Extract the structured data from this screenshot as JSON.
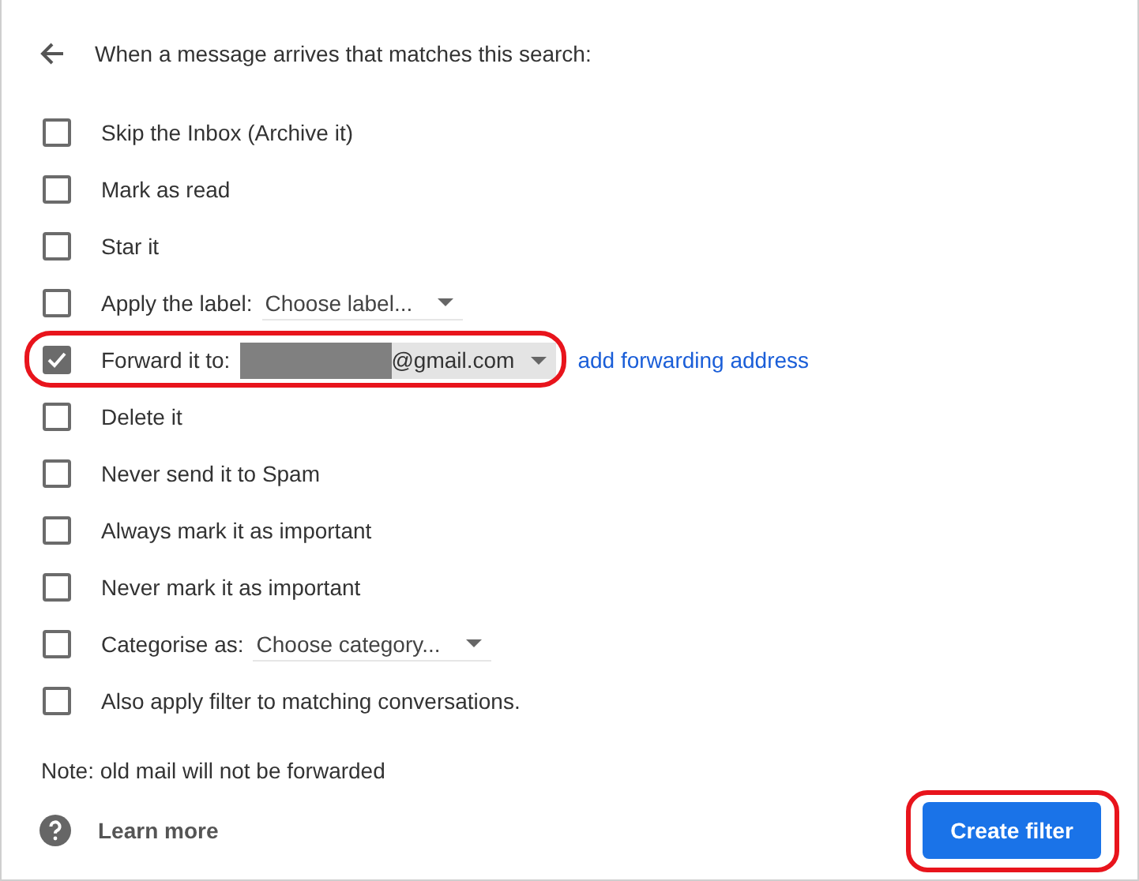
{
  "header": {
    "title": "When a message arrives that matches this search:"
  },
  "options": [
    {
      "kind": "plain",
      "label": "Skip the Inbox (Archive it)",
      "checked": false
    },
    {
      "kind": "plain",
      "label": "Mark as read",
      "checked": false
    },
    {
      "kind": "plain",
      "label": "Star it",
      "checked": false
    },
    {
      "kind": "select",
      "label": "Apply the label:",
      "value": "Choose label...",
      "checked": false
    },
    {
      "kind": "forward",
      "label": "Forward it to:",
      "value": "@gmail.com",
      "link": "add forwarding address",
      "checked": true,
      "highlighted": true
    },
    {
      "kind": "plain",
      "label": "Delete it",
      "checked": false
    },
    {
      "kind": "plain",
      "label": "Never send it to Spam",
      "checked": false
    },
    {
      "kind": "plain",
      "label": "Always mark it as important",
      "checked": false
    },
    {
      "kind": "plain",
      "label": "Never mark it as important",
      "checked": false
    },
    {
      "kind": "select",
      "label": "Categorise as:",
      "value": "Choose category...",
      "checked": false
    },
    {
      "kind": "plain",
      "label": "Also apply filter to matching conversations.",
      "checked": false
    }
  ],
  "note": "Note: old mail will not be forwarded",
  "learn_more": "Learn more",
  "create_button": {
    "label": "Create filter",
    "highlighted": true
  }
}
